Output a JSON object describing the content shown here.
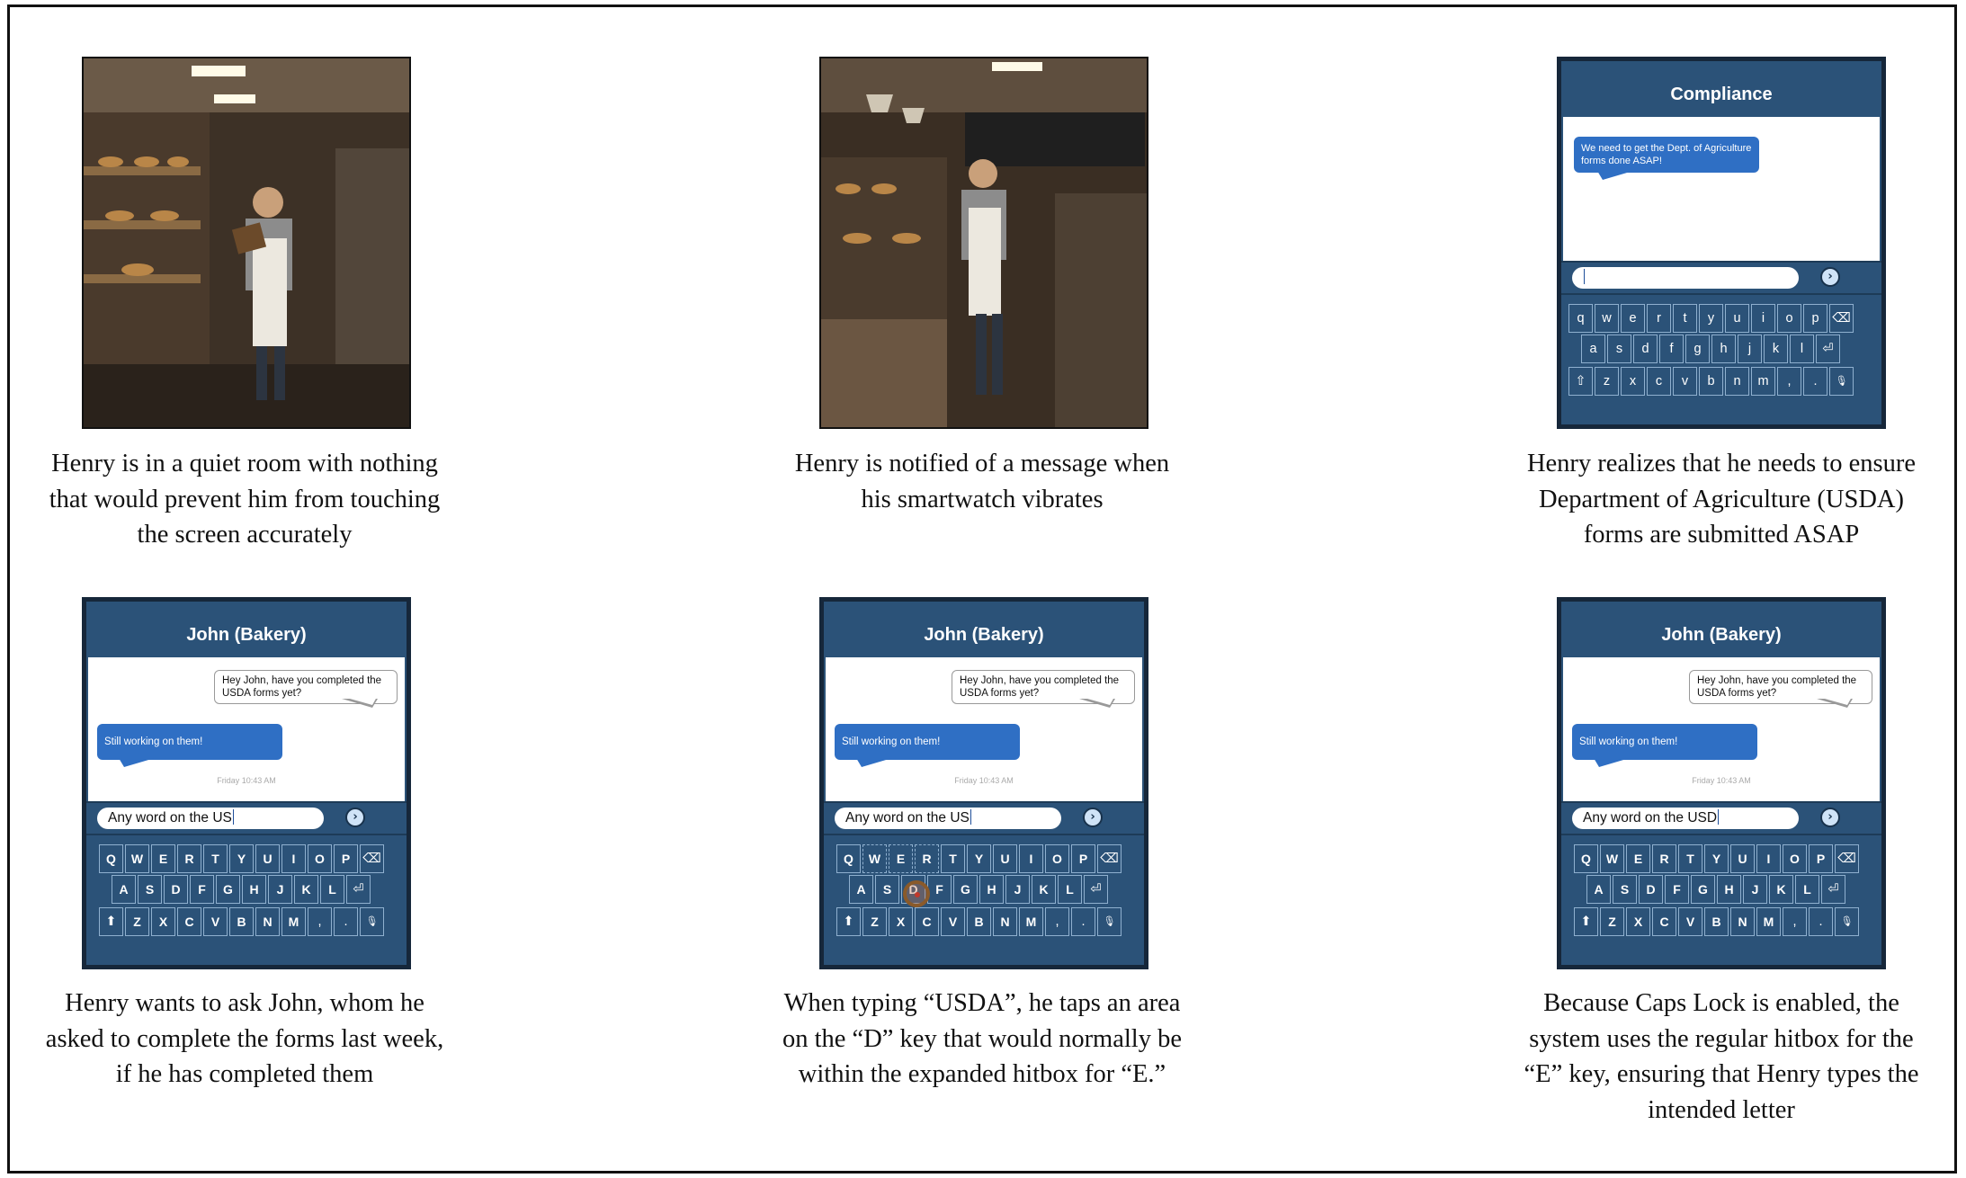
{
  "panels": [
    {
      "type": "photo",
      "caption": [
        "Henry is in a quiet room with nothing",
        "that would prevent him from touching",
        "the screen accurately"
      ]
    },
    {
      "type": "photo",
      "caption": [
        "Henry is notified of a message when",
        "his smartwatch vibrates"
      ]
    },
    {
      "type": "phone",
      "caption": [
        "Henry realizes that he needs to ensure",
        "Department of Agriculture (USDA)",
        "forms are submitted ASAP"
      ]
    },
    {
      "type": "phone",
      "caption": [
        "Henry wants to ask John, whom he",
        "asked to complete the forms last week,",
        "if he has completed them"
      ]
    },
    {
      "type": "phone",
      "caption": [
        "When typing “USDA”, he taps an area",
        "on the “D” key that would normally be",
        "within the expanded hitbox for “E.”"
      ]
    },
    {
      "type": "phone",
      "caption": [
        "Because Caps Lock is enabled, the",
        "system uses the regular hitbox for the",
        "“E” key, ensuring that Henry types the",
        "intended letter"
      ]
    }
  ],
  "compliance": {
    "title": "Compliance",
    "message": "We need to get the Dept. of Agriculture forms done ASAP!",
    "input": "",
    "send_icon": "send-arrow-icon"
  },
  "john_chat": {
    "title": "John (Bakery)",
    "outgoing": "Hey John, have you completed the USDA forms yet?",
    "incoming": "Still working on them!",
    "timestamp": "Friday 10:43 AM",
    "input_panel4": "Any word on the US",
    "input_panel5": "Any word on the US",
    "input_panel6": "Any word on the USD"
  },
  "keyboard_lower": {
    "row1": [
      "q",
      "w",
      "e",
      "r",
      "t",
      "y",
      "u",
      "i",
      "o",
      "p",
      "⌫"
    ],
    "row2": [
      "a",
      "s",
      "d",
      "f",
      "g",
      "h",
      "j",
      "k",
      "l",
      "⏎"
    ],
    "row3": [
      "⇧",
      "z",
      "x",
      "c",
      "v",
      "b",
      "n",
      "m",
      ",",
      ".",
      "🎙"
    ]
  },
  "keyboard_upper": {
    "row1": [
      "Q",
      "W",
      "E",
      "R",
      "T",
      "Y",
      "U",
      "I",
      "O",
      "P",
      "⌫"
    ],
    "row2": [
      "A",
      "S",
      "D",
      "F",
      "G",
      "H",
      "J",
      "K",
      "L",
      "⏎"
    ],
    "row3": [
      "⬆",
      "Z",
      "X",
      "C",
      "V",
      "B",
      "N",
      "M",
      ",",
      ".",
      "🎙"
    ]
  },
  "colors": {
    "phone_bg": "#2b5278",
    "incoming_bubble": "#2f6fc4",
    "touch_marker": "#8a5a2a"
  }
}
